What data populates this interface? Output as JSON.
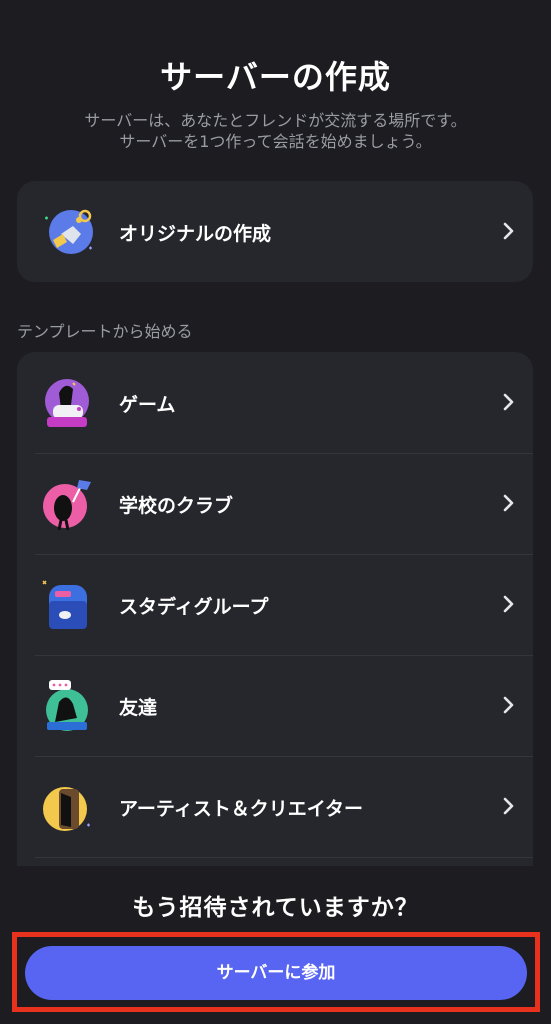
{
  "header": {
    "title": "サーバーの作成",
    "subtitle_line1": "サーバーは、あなたとフレンドが交流する場所です。",
    "subtitle_line2": "サーバーを1つ作って会話を始めましょう。"
  },
  "original": {
    "label": "オリジナルの作成",
    "icon": "original-server-icon"
  },
  "templates": {
    "section_label": "テンプレートから始める",
    "items": [
      {
        "label": "ゲーム",
        "icon": "gaming-icon"
      },
      {
        "label": "学校のクラブ",
        "icon": "school-club-icon"
      },
      {
        "label": "スタディグループ",
        "icon": "study-group-icon"
      },
      {
        "label": "友達",
        "icon": "friends-icon"
      },
      {
        "label": "アーティスト＆クリエイター",
        "icon": "artists-creators-icon"
      }
    ]
  },
  "footer": {
    "invite_question": "もう招待されていますか？",
    "join_button": "サーバーに参加"
  },
  "colors": {
    "background": "#1c1c21",
    "card": "#26262d",
    "accent": "#5865f2",
    "highlight": "#e8321e"
  }
}
